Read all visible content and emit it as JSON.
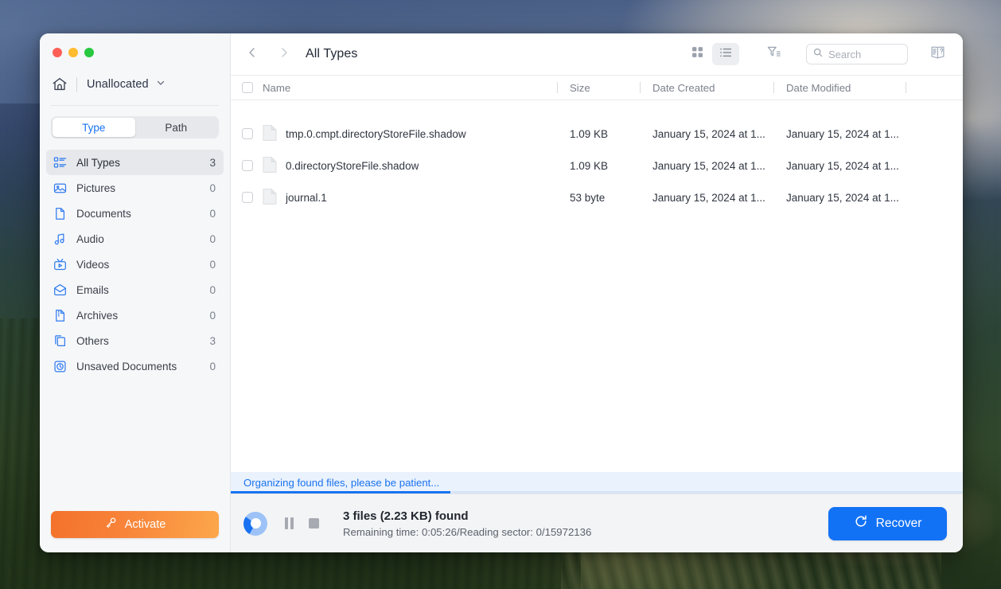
{
  "window": {
    "traffic_lights": [
      "close",
      "minimize",
      "maximize"
    ]
  },
  "sidebar": {
    "drive": {
      "home_icon": "home-icon",
      "name": "Unallocated",
      "chevron_icon": "chevron-down-icon"
    },
    "segmented": {
      "options": [
        "Type",
        "Path"
      ],
      "selected": "Type"
    },
    "items": [
      {
        "icon": "all-types-icon",
        "label": "All Types",
        "count": "3",
        "active": true
      },
      {
        "icon": "pictures-icon",
        "label": "Pictures",
        "count": "0",
        "active": false
      },
      {
        "icon": "documents-icon",
        "label": "Documents",
        "count": "0",
        "active": false
      },
      {
        "icon": "audio-icon",
        "label": "Audio",
        "count": "0",
        "active": false
      },
      {
        "icon": "videos-icon",
        "label": "Videos",
        "count": "0",
        "active": false
      },
      {
        "icon": "emails-icon",
        "label": "Emails",
        "count": "0",
        "active": false
      },
      {
        "icon": "archives-icon",
        "label": "Archives",
        "count": "0",
        "active": false
      },
      {
        "icon": "others-icon",
        "label": "Others",
        "count": "3",
        "active": false
      },
      {
        "icon": "unsaved-documents-icon",
        "label": "Unsaved Documents",
        "count": "0",
        "active": false
      }
    ],
    "activate": {
      "label": "Activate",
      "icon": "key-icon",
      "color": "#f8843a"
    }
  },
  "toolbar": {
    "back_icon": "chevron-left-icon",
    "forward_icon": "chevron-right-icon",
    "title": "All Types",
    "grid_view_icon": "grid-view-icon",
    "list_view_icon": "list-view-icon",
    "active_view": "list",
    "filter_icon": "filter-icon",
    "search": {
      "icon": "search-icon",
      "placeholder": "Search",
      "value": ""
    },
    "help_icon": "book-help-icon"
  },
  "table": {
    "columns": [
      "Name",
      "Size",
      "Date Created",
      "Date Modified"
    ],
    "select_all_checked": false,
    "rows": [
      {
        "checked": false,
        "icon": "file-icon",
        "name": "tmp.0.cmpt.directoryStoreFile.shadow",
        "size": "1.09 KB",
        "date_created": "January 15, 2024 at 1...",
        "date_modified": "January 15, 2024 at 1..."
      },
      {
        "checked": false,
        "icon": "file-icon",
        "name": "0.directoryStoreFile.shadow",
        "size": "1.09 KB",
        "date_created": "January 15, 2024 at 1...",
        "date_modified": "January 15, 2024 at 1..."
      },
      {
        "checked": false,
        "icon": "file-icon",
        "name": "journal.1",
        "size": "53 byte",
        "date_created": "January 15, 2024 at 1...",
        "date_modified": "January 15, 2024 at 1..."
      }
    ]
  },
  "progress": {
    "message": "Organizing found files, please be patient...",
    "percent": 30,
    "accent": "#1a73f0"
  },
  "status": {
    "spinner_icon": "scanning-spinner-icon",
    "pause_icon": "pause-icon",
    "stop_icon": "stop-icon",
    "title": "3 files (2.23 KB) found",
    "subtitle": "Remaining time: 0:05:26/Reading sector: 0/15972136"
  },
  "recover": {
    "label": "Recover",
    "icon": "recover-refresh-icon",
    "color": "#1272f5"
  }
}
